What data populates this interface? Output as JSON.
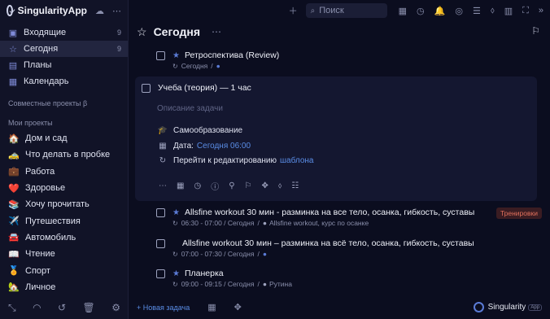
{
  "app": {
    "name": "SingularityApp"
  },
  "sidebar": {
    "nav": [
      {
        "icon": "inbox-icon",
        "glyph": "▣",
        "label": "Входящие",
        "count": "9"
      },
      {
        "icon": "star-icon",
        "glyph": "☆",
        "label": "Сегодня",
        "count": "9"
      },
      {
        "icon": "plans-icon",
        "glyph": "▤",
        "label": "Планы",
        "count": ""
      },
      {
        "icon": "calendar-icon",
        "glyph": "▦",
        "label": "Календарь",
        "count": ""
      }
    ],
    "shared_title": "Совместные проекты β",
    "projects_title": "Мои проекты",
    "projects": [
      {
        "emoji": "🏠",
        "label": "Дом и сад"
      },
      {
        "emoji": "🚕",
        "label": "Что делать в пробке"
      },
      {
        "emoji": "💼",
        "label": "Работа"
      },
      {
        "emoji": "❤️",
        "label": "Здоровье"
      },
      {
        "emoji": "📚",
        "label": "Хочу прочитать"
      },
      {
        "emoji": "✈️",
        "label": "Путешествия"
      },
      {
        "emoji": "🚘",
        "label": "Автомобиль"
      },
      {
        "emoji": "📖",
        "label": "Чтение"
      },
      {
        "emoji": "🏅",
        "label": "Спорт"
      },
      {
        "emoji": "🏡",
        "label": "Личное"
      }
    ]
  },
  "topbar": {
    "search_placeholder": "Поиск"
  },
  "page": {
    "title": "Сегодня"
  },
  "tasks": [
    {
      "title": "Ретроспектива (Review)",
      "meta": "Сегодня",
      "project": ""
    },
    {
      "title": "Allsfine workout 30 мин - разминка на все тело, осанка, гибкость, суставы",
      "meta": "06:30 - 07:00 / Сегодня",
      "project": "Allsfine workout, курс по осанке",
      "tag": "Тренировки"
    },
    {
      "title": "Allsfine workout 30 мин – разминка на всё тело, осанка, гибкость, суставы",
      "meta": "07:00 - 07:30 / Сегодня",
      "project": ""
    },
    {
      "title": "Планерка",
      "meta": "09:00 - 09:15 / Сегодня",
      "project": "Рутина"
    }
  ],
  "expanded_task": {
    "title": "Учеба (теория) — 1 час",
    "description_placeholder": "Описание задачи",
    "project": "Самообразование",
    "date_label": "Дата:",
    "date_value": "Сегодня 06:00",
    "repeat_text": "Перейти к редактированию",
    "repeat_link": "шаблона"
  },
  "bottom": {
    "new_task": "+ Новая задача"
  },
  "brand": {
    "name": "Singularity",
    "badge": "App"
  },
  "colors": {
    "background": "#0b0d1f",
    "sidebar": "#111327",
    "accent": "#5b7bd6",
    "tag": "#e0705c"
  }
}
